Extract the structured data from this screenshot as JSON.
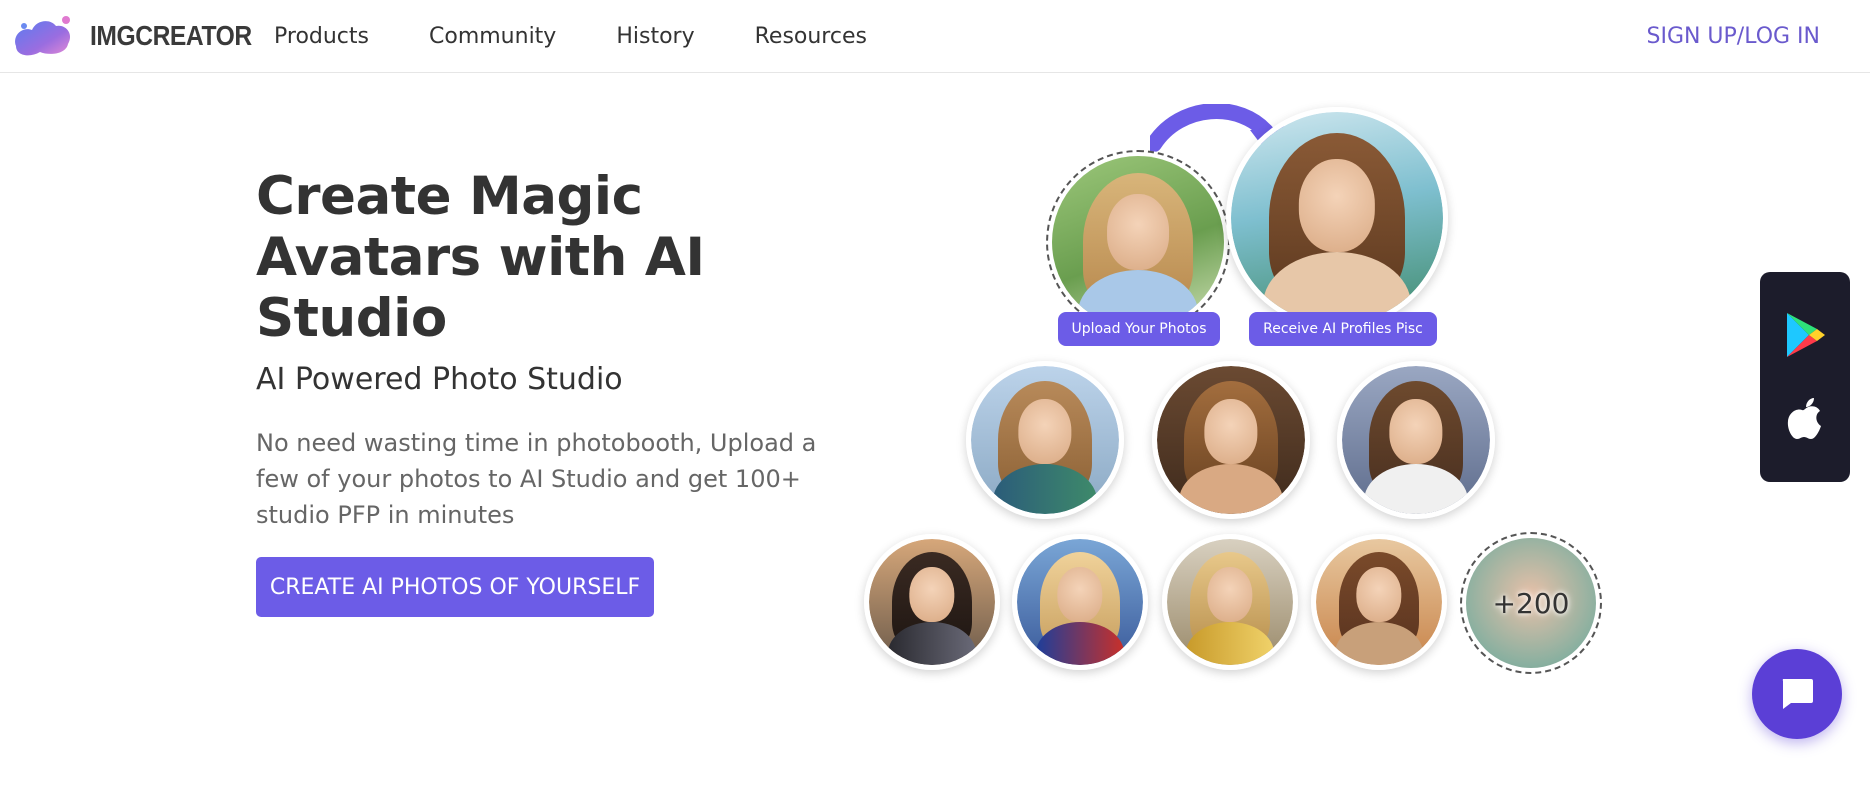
{
  "header": {
    "logo_text": "IMGCREATOR",
    "nav": [
      "Products",
      "Community",
      "History",
      "Resources"
    ],
    "login_label": "SIGN UP/LOG IN"
  },
  "hero": {
    "title": "Create Magic Avatars with AI Studio",
    "subtitle": "AI Powered Photo Studio",
    "description": "No need wasting time in photobooth, Upload a few of your photos to AI Studio and get 100+ studio PFP in minutes",
    "cta_label": "CREATE AI PHOTOS OF YOURSELF"
  },
  "showcase": {
    "upload_label": "Upload Your Photos",
    "receive_label": "Receive AI Profiles Pisc",
    "more_count": "+200"
  },
  "colors": {
    "accent": "#6c5ce7",
    "login": "#6a5acd",
    "panel": "#1c1c2b",
    "chat": "#5b3fd6"
  },
  "icons": {
    "store_1": "google-play-icon",
    "store_2": "apple-icon",
    "chat": "chat-icon"
  }
}
